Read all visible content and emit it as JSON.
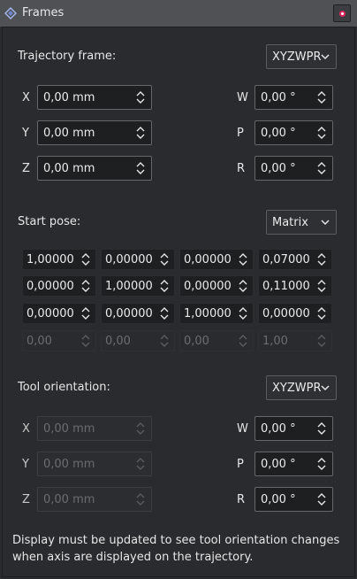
{
  "window": {
    "title": "Frames",
    "icon": "diamond-app-icon",
    "close_icon": "close-icon"
  },
  "trajectory_frame": {
    "label": "Trajectory frame:",
    "combo": "XYZWPR",
    "fields": [
      {
        "axis": "X",
        "value": "0,00 mm"
      },
      {
        "axis": "Y",
        "value": "0,00 mm"
      },
      {
        "axis": "Z",
        "value": "0,00 mm"
      },
      {
        "axis": "W",
        "value": "0,00 °"
      },
      {
        "axis": "P",
        "value": "0,00 °"
      },
      {
        "axis": "R",
        "value": "0,00 °"
      }
    ]
  },
  "start_pose": {
    "label": "Start pose:",
    "combo": "Matrix",
    "matrix": [
      [
        "1,00000",
        "0,00000",
        "0,00000",
        "0,07000"
      ],
      [
        "0,00000",
        "1,00000",
        "0,00000",
        "0,11000"
      ],
      [
        "0,00000",
        "0,00000",
        "1,00000",
        "0,00000"
      ],
      [
        "0,00",
        "0,00",
        "0,00",
        "1,00"
      ]
    ]
  },
  "tool_orientation": {
    "label": "Tool orientation:",
    "combo": "XYZWPR",
    "fields": [
      {
        "axis": "X",
        "value": "0,00 mm"
      },
      {
        "axis": "Y",
        "value": "0,00 mm"
      },
      {
        "axis": "Z",
        "value": "0,00 mm"
      },
      {
        "axis": "W",
        "value": "0,00 °"
      },
      {
        "axis": "P",
        "value": "0,00 °"
      },
      {
        "axis": "R",
        "value": "0,00 °"
      }
    ]
  },
  "note": "Display must be updated to see tool orientation changes when axis are displayed on the trajectory.",
  "colors": {
    "accent_close": "#e0245e",
    "background": "#2a2b2e",
    "titlebar": "#4f5155"
  }
}
